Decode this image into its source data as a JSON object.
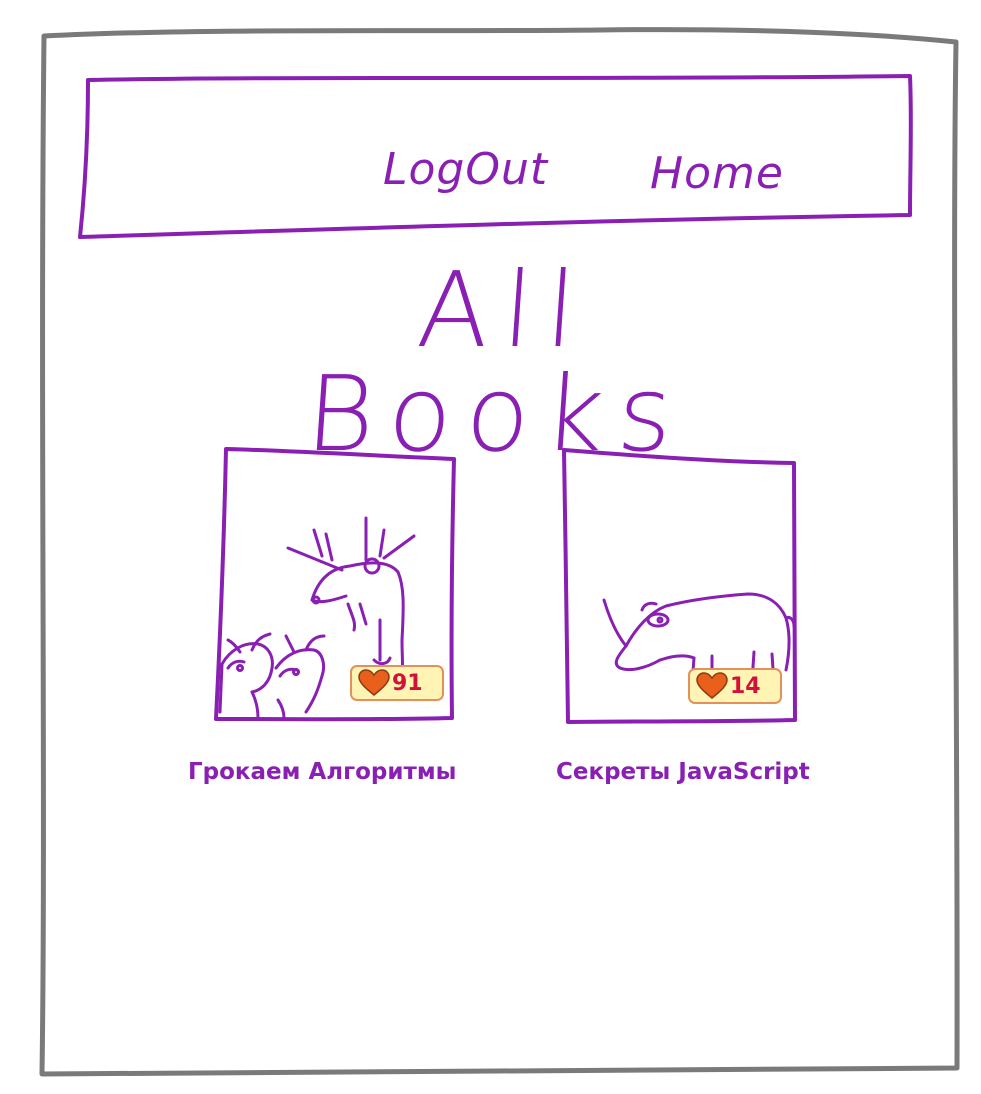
{
  "nav": {
    "logout_label": "LogOut",
    "home_label": "Home"
  },
  "page": {
    "title": "All Books"
  },
  "books": [
    {
      "title": "Грокаем Алгоритмы",
      "likes": "91",
      "cover_icon": "cartoon-animals-icon"
    },
    {
      "title": "Секреты JavaScript",
      "likes": "14",
      "cover_icon": "rhino-icon"
    }
  ],
  "colors": {
    "ink": "#8a1fb3",
    "frame": "#7a7a7a",
    "likes_bg": "#fff4b3",
    "likes_border": "#e2915b",
    "heart": "#e8601c",
    "likes_text": "#d0113a"
  }
}
